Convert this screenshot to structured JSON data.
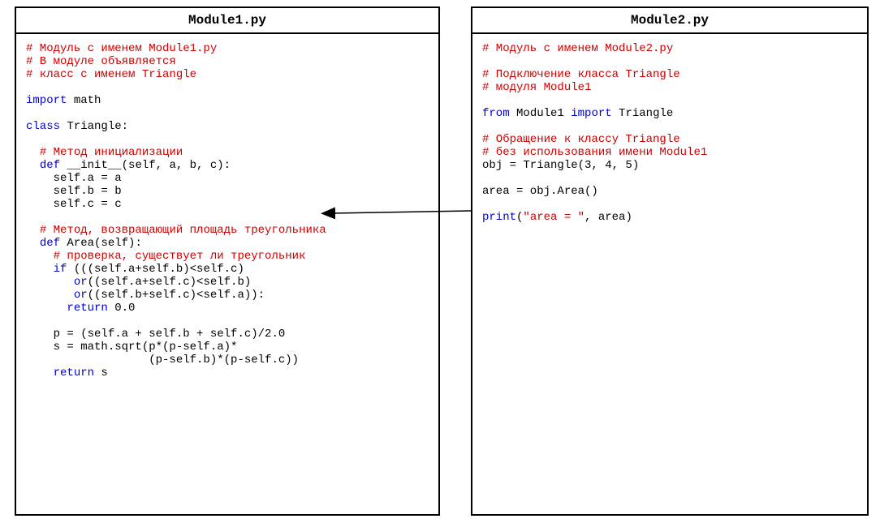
{
  "module1": {
    "title": "Module1.py",
    "lines": [
      [
        {
          "t": "# Модуль с именем Module1.py",
          "c": "cm"
        }
      ],
      [
        {
          "t": "# В модуле объявляется",
          "c": "cm"
        }
      ],
      [
        {
          "t": "# класс с именем Triangle",
          "c": "cm"
        }
      ],
      [
        {
          "t": "",
          "c": "pl"
        }
      ],
      [
        {
          "t": "import",
          "c": "kw"
        },
        {
          "t": " math",
          "c": "pl"
        }
      ],
      [
        {
          "t": "",
          "c": "pl"
        }
      ],
      [
        {
          "t": "class",
          "c": "kw"
        },
        {
          "t": " Triangle:",
          "c": "pl"
        }
      ],
      [
        {
          "t": "",
          "c": "pl"
        }
      ],
      [
        {
          "t": "  ",
          "c": "pl"
        },
        {
          "t": "# Метод инициализации",
          "c": "cm"
        }
      ],
      [
        {
          "t": "  ",
          "c": "pl"
        },
        {
          "t": "def",
          "c": "kw"
        },
        {
          "t": " __init__(self, a, b, c):",
          "c": "pl"
        }
      ],
      [
        {
          "t": "    self.a = a",
          "c": "pl"
        }
      ],
      [
        {
          "t": "    self.b = b",
          "c": "pl"
        }
      ],
      [
        {
          "t": "    self.c = c",
          "c": "pl"
        }
      ],
      [
        {
          "t": "",
          "c": "pl"
        }
      ],
      [
        {
          "t": "  ",
          "c": "pl"
        },
        {
          "t": "# Метод, возвращающий площадь треугольника",
          "c": "cm"
        }
      ],
      [
        {
          "t": "  ",
          "c": "pl"
        },
        {
          "t": "def",
          "c": "kw"
        },
        {
          "t": " Area(self):",
          "c": "pl"
        }
      ],
      [
        {
          "t": "    ",
          "c": "pl"
        },
        {
          "t": "# проверка, существует ли треугольник",
          "c": "cm"
        }
      ],
      [
        {
          "t": "    ",
          "c": "pl"
        },
        {
          "t": "if",
          "c": "kw"
        },
        {
          "t": " (((self.a+self.b)<self.c)",
          "c": "pl"
        }
      ],
      [
        {
          "t": "       ",
          "c": "pl"
        },
        {
          "t": "or",
          "c": "kw"
        },
        {
          "t": "((self.a+self.c)<self.b)",
          "c": "pl"
        }
      ],
      [
        {
          "t": "       ",
          "c": "pl"
        },
        {
          "t": "or",
          "c": "kw"
        },
        {
          "t": "((self.b+self.c)<self.a)):",
          "c": "pl"
        }
      ],
      [
        {
          "t": "      ",
          "c": "pl"
        },
        {
          "t": "return",
          "c": "kw"
        },
        {
          "t": " 0.0",
          "c": "pl"
        }
      ],
      [
        {
          "t": "",
          "c": "pl"
        }
      ],
      [
        {
          "t": "    p = (self.a + self.b + self.c)/2.0",
          "c": "pl"
        }
      ],
      [
        {
          "t": "    s = math.sqrt(p*(p-self.a)*",
          "c": "pl"
        }
      ],
      [
        {
          "t": "                  (p-self.b)*(p-self.c))",
          "c": "pl"
        }
      ],
      [
        {
          "t": "    ",
          "c": "pl"
        },
        {
          "t": "return",
          "c": "kw"
        },
        {
          "t": " s",
          "c": "pl"
        }
      ]
    ]
  },
  "module2": {
    "title": "Module2.py",
    "lines": [
      [
        {
          "t": "# Модуль с именем Module2.py",
          "c": "cm"
        }
      ],
      [
        {
          "t": "",
          "c": "pl"
        }
      ],
      [
        {
          "t": "# Подключение класса Triangle",
          "c": "cm"
        }
      ],
      [
        {
          "t": "# модуля Module1",
          "c": "cm"
        }
      ],
      [
        {
          "t": "",
          "c": "pl"
        }
      ],
      [
        {
          "t": "from",
          "c": "kw"
        },
        {
          "t": " Module1 ",
          "c": "pl"
        },
        {
          "t": "import",
          "c": "kw"
        },
        {
          "t": " Triangle",
          "c": "pl"
        }
      ],
      [
        {
          "t": "",
          "c": "pl"
        }
      ],
      [
        {
          "t": "# Обращение к классу Triangle",
          "c": "cm"
        }
      ],
      [
        {
          "t": "# без использования имени Module1",
          "c": "cm"
        }
      ],
      [
        {
          "t": "obj = Triangle(3, 4, 5)",
          "c": "pl"
        }
      ],
      [
        {
          "t": "",
          "c": "pl"
        }
      ],
      [
        {
          "t": "area = obj.Area()",
          "c": "pl"
        }
      ],
      [
        {
          "t": "",
          "c": "pl"
        }
      ],
      [
        {
          "t": "print",
          "c": "kw"
        },
        {
          "t": "(",
          "c": "pl"
        },
        {
          "t": "\"area = \"",
          "c": "str"
        },
        {
          "t": ", area)",
          "c": "pl"
        }
      ]
    ]
  }
}
